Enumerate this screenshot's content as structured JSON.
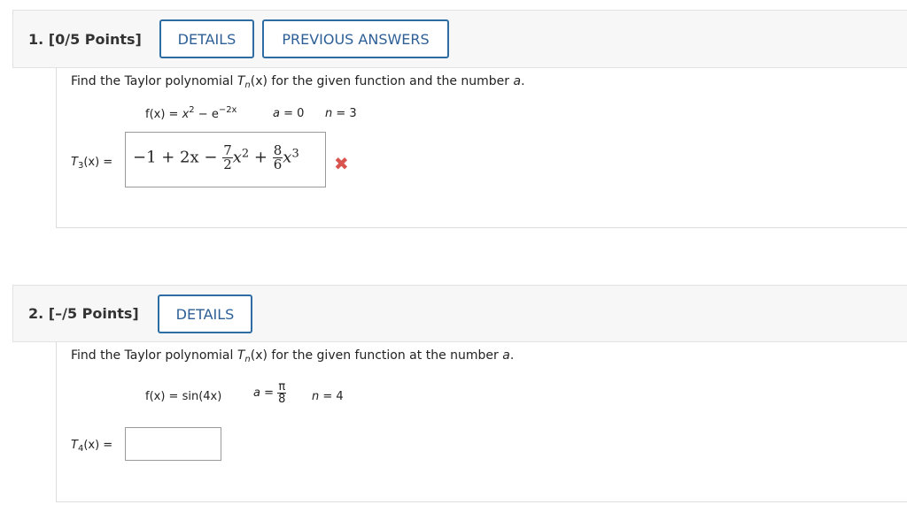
{
  "questions": [
    {
      "number_label": "1. [0/5 Points]",
      "buttons": {
        "details": "DETAILS",
        "previous_answers": "PREVIOUS ANSWERS"
      },
      "prompt": {
        "pre": "Find the Taylor polynomial ",
        "T": "T",
        "n": "n",
        "x": "(x)",
        "post": " for the given function and the number ",
        "a": "a",
        "end": "."
      },
      "function": {
        "fx": "f(x) = ",
        "x": "x",
        "exp2": "2",
        "minus_e": " − e",
        "exp": "−2x"
      },
      "a_label": "a",
      "a_value": " = 0",
      "n_label": "n",
      "n_value": " = 3",
      "answer_label": {
        "T": "T",
        "sub": "3",
        "rest": "(x) ="
      },
      "answer": {
        "p1": "−1 + 2x −",
        "n1": "7",
        "d1": "2",
        "p2": "x",
        "e2": "2",
        "p3": " +",
        "n2": "8",
        "d2": "6",
        "p4": "x",
        "e3": "3"
      },
      "status_icon": "x-mark-icon",
      "status_color": "#d9534f"
    },
    {
      "number_label": "2. [–/5 Points]",
      "buttons": {
        "details": "DETAILS"
      },
      "prompt": {
        "pre": "Find the Taylor polynomial ",
        "T": "T",
        "n": "n",
        "x": "(x)",
        "post": " for the given function at the number ",
        "a": "a",
        "end": "."
      },
      "function": "f(x) = sin(4x)",
      "a_label": "a",
      "a_eq": " =",
      "a_num": "π",
      "a_den": "8",
      "n_label": "n",
      "n_value": " = 4",
      "answer_label": {
        "T": "T",
        "sub": "4",
        "rest": "(x) ="
      },
      "answer_value": ""
    }
  ],
  "accent_color": "#2e6ca4"
}
